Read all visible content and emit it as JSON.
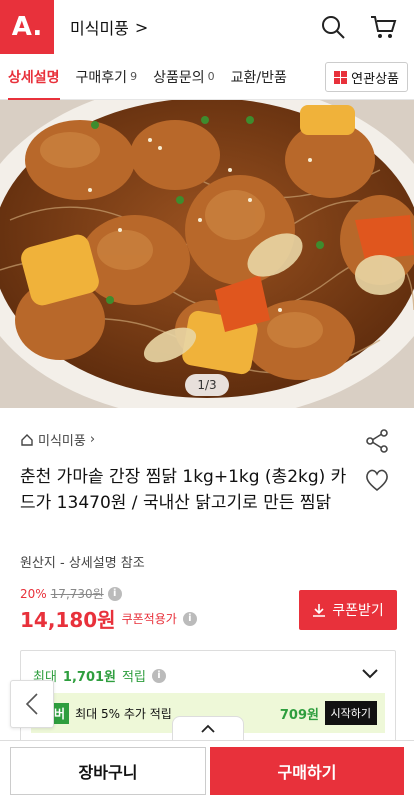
{
  "header": {
    "logo": "A.",
    "brand": "미식미풍",
    "brand_chevron": ">"
  },
  "tabs": [
    {
      "label": "상세설명",
      "count": ""
    },
    {
      "label": "구매후기",
      "count": "9"
    },
    {
      "label": "상품문의",
      "count": "0"
    },
    {
      "label": "교환/반품",
      "count": ""
    }
  ],
  "related_button": "연관상품",
  "hero": {
    "counter": "1/3"
  },
  "product": {
    "breadcrumb": "미식미풍",
    "title": "춘천 가마솥 간장 찜닭 1kg+1kg (총2kg) 카드가 13470원 / 국내산 닭고기로 만든 찜닭",
    "origin": "원산지 - 상세설명 참조",
    "discount": "20%",
    "original_price": "17,730원",
    "price": "14,180원",
    "coupon_applied": "쿠폰적용가",
    "coupon_button": "쿠폰받기"
  },
  "reward": {
    "prefix": "최대",
    "amount": "1,701원",
    "suffix": "적립",
    "member_tag": "멤버",
    "member_text": "최대 5% 추가 적립",
    "member_amount": "709원",
    "start_button": "시작하기"
  },
  "bottom": {
    "cart": "장바구니",
    "buy": "구매하기"
  },
  "colors": {
    "accent": "#e8313b",
    "reward_green": "#2e9e3e"
  }
}
